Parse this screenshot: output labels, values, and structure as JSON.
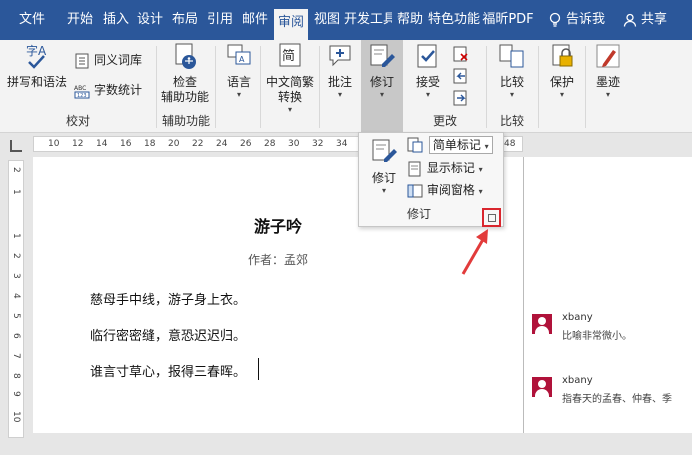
{
  "tabs": [
    {
      "label": "文件"
    },
    {
      "label": "开始"
    },
    {
      "label": "插入"
    },
    {
      "label": "设计"
    },
    {
      "label": "布局"
    },
    {
      "label": "引用"
    },
    {
      "label": "邮件"
    },
    {
      "label": "审阅"
    },
    {
      "label": "视图"
    },
    {
      "label": "开发工具"
    },
    {
      "label": "帮助"
    },
    {
      "label": "特色功能"
    },
    {
      "label": "福昕PDF"
    }
  ],
  "active_tab": "审阅",
  "tell_me": "告诉我",
  "share": "共享",
  "ribbon": {
    "proofing": {
      "spelling": "拼写和语法",
      "thesaurus": "同义词库",
      "word_count": "字数统计",
      "group_label": "校对"
    },
    "accessibility": {
      "check_line1": "检查",
      "check_line2": "辅助功能",
      "group_label": "辅助功能"
    },
    "language": {
      "label": "语言"
    },
    "chinese_convert": {
      "line1": "中文简繁",
      "line2": "转换"
    },
    "comments": {
      "label": "批注"
    },
    "tracking": {
      "label": "修订",
      "group_label": ""
    },
    "changes": {
      "accept": "接受",
      "group_label": "更改"
    },
    "compare": {
      "label": "比较",
      "group_label": "比较"
    },
    "protect": {
      "label": "保护"
    },
    "ink": {
      "label": "墨迹"
    }
  },
  "tracking_panel": {
    "track_changes": "修订",
    "simple_markup": "简单标记",
    "show_markup": "显示标记",
    "reviewing_pane": "审阅窗格",
    "group_label": "修订"
  },
  "ruler": {
    "h_ticks": [
      "10",
      "12",
      "14",
      "16",
      "18",
      "20",
      "22",
      "24",
      "26",
      "28",
      "30",
      "32",
      "34",
      "36",
      "38",
      "40",
      "42",
      "44",
      "46",
      "48"
    ],
    "v_ticks": [
      "2",
      "1",
      "1",
      "2",
      "3",
      "4",
      "5",
      "6",
      "7",
      "8",
      "9",
      "10",
      "11"
    ]
  },
  "document": {
    "title": "游子吟",
    "author": "作者：孟郊",
    "lines": [
      "慈母手中线，游子身上衣。",
      "临行密密缝，意恐迟迟归。",
      "谁言寸草心，报得三春晖。"
    ]
  },
  "comments": [
    {
      "author": "xbany",
      "text": "比喻非常微小。"
    },
    {
      "author": "xbany",
      "text": "指春天的孟春、仲春、季"
    }
  ],
  "colors": {
    "accent": "#2b579a",
    "highlight_box": "#d9262e",
    "arrow": "#e23b3b",
    "avatar": "#b0123a"
  }
}
